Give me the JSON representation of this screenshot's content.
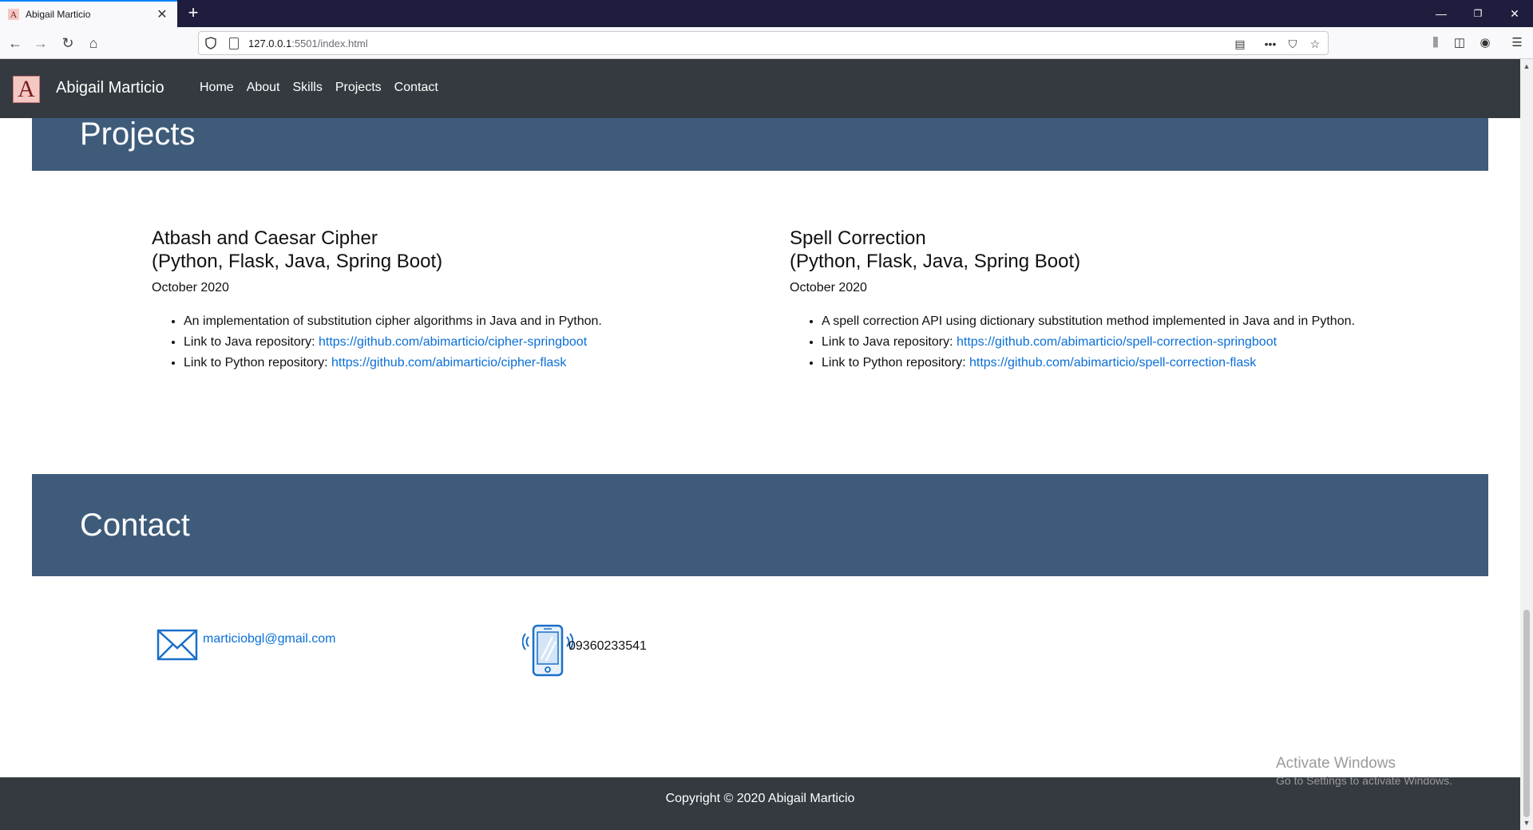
{
  "browser": {
    "tab_title": "Abigail Marticio",
    "tab_favicon": "A",
    "url_host": "127.0.0.1",
    "url_rest": ":5501/index.html"
  },
  "site": {
    "logo_letter": "A",
    "brand": "Abigail Marticio",
    "nav": [
      "Home",
      "About",
      "Skills",
      "Projects",
      "Contact"
    ]
  },
  "projects_section": {
    "title": "Projects",
    "items": [
      {
        "title_line1": "Atbash and Caesar Cipher",
        "title_line2": "(Python, Flask, Java, Spring Boot)",
        "date": "October 2020",
        "desc": "An implementation of substitution cipher algorithms in Java and in Python.",
        "java_label": "Link to Java repository: ",
        "java_url": "https://github.com/abimarticio/cipher-springboot",
        "python_label": "Link to Python repository: ",
        "python_url": "https://github.com/abimarticio/cipher-flask"
      },
      {
        "title_line1": "Spell Correction",
        "title_line2": "(Python, Flask, Java, Spring Boot)",
        "date": "October 2020",
        "desc": "A spell correction API using dictionary substitution method implemented in Java and in Python.",
        "java_label": "Link to Java repository: ",
        "java_url": "https://github.com/abimarticio/spell-correction-springboot",
        "python_label": "Link to Python repository: ",
        "python_url": "https://github.com/abimarticio/spell-correction-flask"
      }
    ]
  },
  "contact_section": {
    "title": "Contact",
    "email": "marticiobgl@gmail.com",
    "phone": "09360233541"
  },
  "footer": {
    "copyright": "Copyright © 2020 Abigail Marticio"
  },
  "watermark": {
    "line1": "Activate Windows",
    "line2": "Go to Settings to activate Windows."
  },
  "colors": {
    "navbar": "#343a40",
    "banner": "#3e5b7a",
    "link": "#0a6fd8"
  }
}
